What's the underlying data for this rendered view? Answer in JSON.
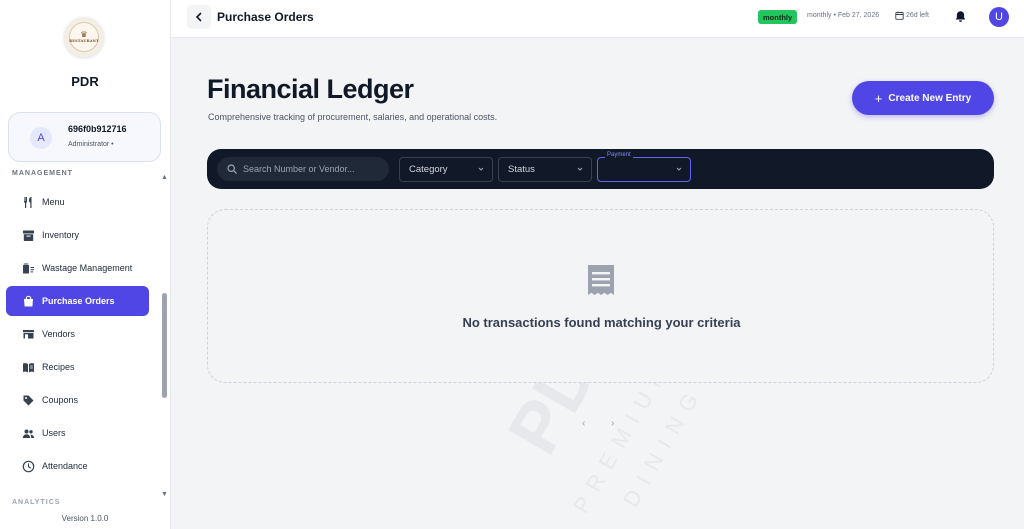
{
  "sidebar": {
    "logo_text": "RESTAURANT",
    "brand": "PDR",
    "user": {
      "avatar_letter": "A",
      "id": "696f0b912716",
      "role": "Administrator •"
    },
    "section_management": "MANAGEMENT",
    "section_analytics": "ANALYTICS",
    "items": [
      {
        "label": "Menu",
        "icon": "utensils-icon"
      },
      {
        "label": "Inventory",
        "icon": "archive-box-icon"
      },
      {
        "label": "Wastage Management",
        "icon": "waste-bin-icon"
      },
      {
        "label": "Purchase Orders",
        "icon": "shopping-bag-icon",
        "active": true
      },
      {
        "label": "Vendors",
        "icon": "truck-icon"
      },
      {
        "label": "Recipes",
        "icon": "book-icon"
      },
      {
        "label": "Coupons",
        "icon": "tag-icon"
      },
      {
        "label": "Users",
        "icon": "users-icon"
      },
      {
        "label": "Attendance",
        "icon": "clock-icon"
      }
    ],
    "version": "Version 1.0.0"
  },
  "topbar": {
    "title": "Purchase Orders",
    "badge": "monthly",
    "plan_info": "monthly • Feb 27, 2026",
    "days_left": "26d left",
    "user_letter": "U"
  },
  "main": {
    "title": "Financial Ledger",
    "subtitle": "Comprehensive tracking of procurement, salaries, and operational costs.",
    "create_label": "Create New Entry",
    "filters": {
      "search_placeholder": "Search Number or Vendor...",
      "category": "Category",
      "status": "Status",
      "payment_label": "Payment"
    },
    "empty_message": "No transactions found matching your criteria",
    "pager_prev": "‹",
    "pager_next": "›"
  },
  "colors": {
    "accent": "#4f46e5",
    "badge": "#22c55e",
    "filter_bar": "#111827"
  }
}
